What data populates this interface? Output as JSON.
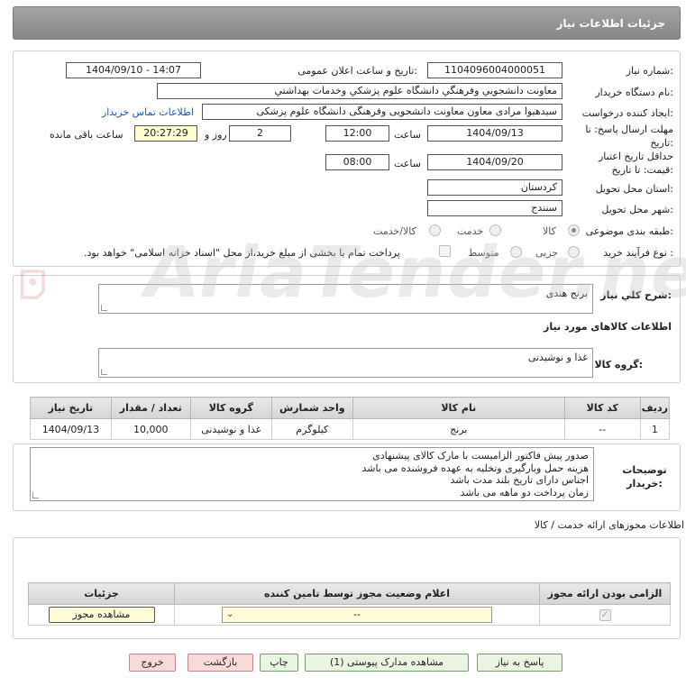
{
  "header": {
    "title": "جزئیات اطلاعات نیاز"
  },
  "form": {
    "need_number_label": "شماره نیاز:",
    "need_number": "1104096004000051",
    "announce_label": "تاریخ و ساعت اعلان عمومی:",
    "announce_value": "1404/09/10 - 14:07",
    "buyer_org_label": "نام دستگاه خریدار:",
    "buyer_org": "معاونت دانشجويي وفرهنگي دانشگاه علوم پزشكي وخدمات بهداشتي",
    "requester_label": "ایجاد کننده درخواست:",
    "requester": "سیدهیوا مرادی معاون معاونت دانشجویی وفرهنگی دانشگاه علوم پزشکی",
    "contact_link": "اطلاعات تماس خریدار",
    "deadline_label": "مهلت ارسال پاسخ: تا تاریخ:",
    "deadline_date": "1404/09/13",
    "time_label": "ساعت",
    "deadline_time": "12:00",
    "days_value": "2",
    "days_label": "روز و",
    "remaining_time": "20:27:29",
    "remaining_label": "ساعت باقی مانده",
    "validity_label": "حداقل تاریخ اعتبار قیمت: تا تاریخ:",
    "validity_date": "1404/09/20",
    "validity_time": "08:00",
    "province_label": "استان محل تحویل:",
    "province": "کردستان",
    "city_label": "شهر محل تحویل:",
    "city": "سنندج",
    "category_label": "طبقه بندی موضوعی:",
    "category_options": [
      "کالا",
      "خدمت",
      "کالا/خدمت"
    ],
    "process_label": "نوع فرآیند خرید :",
    "process_options": [
      "جزیی",
      "متوسط"
    ],
    "payment_note": "پرداخت تمام یا بخشی از مبلغ خرید،از محل \"اسناد خزانه اسلامی\" خواهد بود."
  },
  "summary": {
    "label": "شرح کلي نياز:",
    "value": "برنج هندی"
  },
  "goods_info_title": "اطلاعات کالاهای مورد نیاز",
  "goods_group": {
    "label": "گروه کالا:",
    "value": "غذا و نوشیدنی"
  },
  "items_table": {
    "headers": [
      "ردیف",
      "کد کالا",
      "نام کالا",
      "واحد شمارش",
      "گروه کالا",
      "تعداد / مقدار",
      "تاریخ نیاز"
    ],
    "rows": [
      [
        "1",
        "--",
        "برنج",
        "کیلوگرم",
        "غذا و نوشیدنی",
        "10,000",
        "1404/09/13"
      ]
    ]
  },
  "buyer_notes": {
    "label": "توضیحات خریدار:",
    "lines": [
      "صدور پیش فاکتور الزامیست با مارک کالای پیشنهادی",
      "هزینه حمل وبارگیری وتخلیه به عهده فروشنده می باشد",
      "اجناس دارای تاریخ بلند مدت باشد",
      "زمان پرداخت دو ماهه می باشد"
    ]
  },
  "permits": {
    "title": "اطلاعات مجوزهای ارائه خدمت / کالا",
    "headers": [
      "الزامی بودن ارائه مجوز",
      "اعلام وضعیت مجوز توسط تامین کننده",
      "جزئیات"
    ],
    "select_value": "--",
    "view_button": "مشاهده مجوز"
  },
  "buttons": {
    "reply": "پاسخ به نیاز",
    "attachments": "مشاهده مدارک پیوستی (1)",
    "print": "چاپ",
    "back": "بازگشت",
    "exit": "خروج"
  },
  "watermark": {
    "text": "AriaTender.net"
  }
}
